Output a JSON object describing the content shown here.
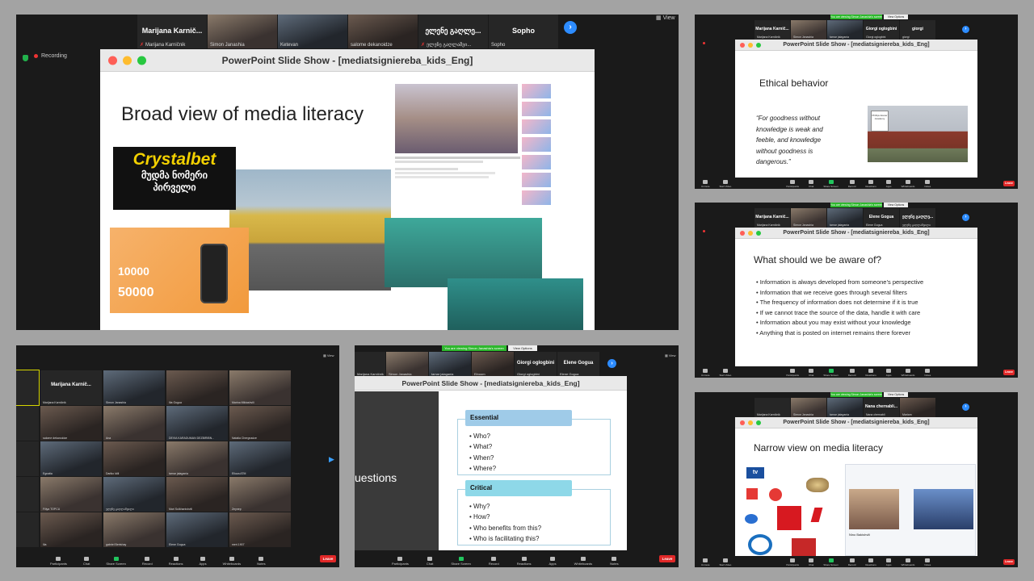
{
  "panel1": {
    "participants": [
      {
        "big": "Marijana  Karnič...",
        "name": "Marijana Karničnik"
      },
      {
        "big": "",
        "name": "Simon Janashia"
      },
      {
        "big": "",
        "name": "Ketevan"
      },
      {
        "big": "",
        "name": "salome dekanoidze"
      },
      {
        "big": "ელენე გაღლე...",
        "name": "ელენე გაღლაშვი..."
      },
      {
        "big": "Sopho",
        "name": "Sopho"
      }
    ],
    "view": "View",
    "recording": "Recording",
    "window_title": "PowerPoint Slide Show - [mediatsignierebа_kids_Eng]",
    "slide_title": "Broad view of media literacy",
    "crystalbet": "Crystalbet",
    "crystal_sub1": "მუდმა ნომერი",
    "crystal_sub2": "პირველი",
    "promo_num1": "10000",
    "promo_num2": "50000"
  },
  "panel2": {
    "banner": "You are viewing Simon Janashia's screen",
    "view_options": "View Options",
    "participants": [
      {
        "big": "Marijana  Karnič...",
        "name": "Marijana Karničnik"
      },
      {
        "big": "",
        "name": "Simon Janashia"
      },
      {
        "big": "",
        "name": "tamar jalagania"
      },
      {
        "big": "Giorgi oglogbini",
        "name": "Giorgi oglogbini"
      },
      {
        "big": "giorgi",
        "name": "giorgi"
      }
    ],
    "window_title": "PowerPoint Slide Show - [mediatsignierebа_kids_Eng]",
    "slide_title": "Ethical behavior",
    "quote": "“For goodness without knowledge is weak and feeble, and knowledge without goodness is dangerous.”",
    "sign_text": "Phillips Exeter Academy",
    "toolbar": [
      "Unmute",
      "Start Video",
      "Participants",
      "Chat",
      "Share Screen",
      "Record",
      "Reactions",
      "Apps",
      "Whiteboards",
      "Notes"
    ],
    "leave": "Leave"
  },
  "panel3": {
    "banner": "You are viewing Simon Janashia's screen",
    "view_options": "View Options",
    "participants": [
      {
        "big": "Marijana  Karnič...",
        "name": "Marijana Karničnik"
      },
      {
        "big": "",
        "name": "Simon Janashia"
      },
      {
        "big": "",
        "name": "tamar jalagania"
      },
      {
        "big": "Elene Gogua",
        "name": "Elene Gogua"
      },
      {
        "big": "ელენე გაღლე...",
        "name": "ელენე გაღლაშვილი"
      }
    ],
    "window_title": "PowerPoint Slide Show - [mediatsignierebа_kids_Eng]",
    "slide_title": "What should we be aware of?",
    "bullets": [
      "Information is always developed from someone’s perspective",
      "Information that we receive goes through several filters",
      "The frequency of information does not determine if it is true",
      "If we cannot trace the source of the data, handle it with care",
      "Information about you may exist without your knowledge",
      "Anything that is posted on internet remains there forever"
    ],
    "toolbar": [
      "Unmute",
      "Start Video",
      "Participants",
      "Chat",
      "Share Screen",
      "Record",
      "Reactions",
      "Apps",
      "Whiteboards",
      "Notes"
    ],
    "leave": "Leave"
  },
  "panel4": {
    "banner": "You are viewing Simon Janashia's screen",
    "view_options": "View Options",
    "participants": [
      {
        "big": "",
        "name": "Marijana Karničnik"
      },
      {
        "big": "",
        "name": "Simon Janashia"
      },
      {
        "big": "",
        "name": "tamar jalagania"
      },
      {
        "big": "Nana  chernabli...",
        "name": "Nana chernabli"
      },
      {
        "big": "",
        "name": "Mariam"
      }
    ],
    "window_title": "PowerPoint Slide Show - [mediatsignierebа_kids_Eng]",
    "slide_title": "Narrow view on media literacy",
    "person_name": "Nino Bakishvili",
    "toolbar": [
      "Unmute",
      "Start Video",
      "Participants",
      "Chat",
      "Share Screen",
      "Record",
      "Reactions",
      "Apps",
      "Whiteboards",
      "Notes"
    ],
    "leave": "Leave"
  },
  "panel5": {
    "view": "View",
    "grid": [
      {
        "big": "",
        "name": ""
      },
      {
        "big": "Marijana  Karnič...",
        "name": "Marijana Karničnik"
      },
      {
        "big": "",
        "name": "Simon Janashia"
      },
      {
        "big": "",
        "name": "Ilia Gogua"
      },
      {
        "big": "",
        "name": "Marina Mikiashvili"
      },
      {
        "big": "",
        "name": ""
      },
      {
        "big": "",
        "name": "salome dekanoidze"
      },
      {
        "big": "",
        "name": "Ana"
      },
      {
        "big": "",
        "name": "DEVIA KARADUMAN DEZBIRIBN..."
      },
      {
        "big": "",
        "name": "Natalia Chergnadze"
      },
      {
        "big": "",
        "name": ""
      },
      {
        "big": "",
        "name": "Egnatia"
      },
      {
        "big": "",
        "name": "Dariko Idili"
      },
      {
        "big": "",
        "name": "tamar jalagania"
      },
      {
        "big": "",
        "name": "Eliuza ATM"
      },
      {
        "big": "",
        "name": ""
      },
      {
        "big": "",
        "name": "Filiya TOPCU"
      },
      {
        "big": "",
        "name": "ელენე გაღლაშვილი"
      },
      {
        "big": "",
        "name": "Mari Sulkhanishvili"
      },
      {
        "big": "",
        "name": "Zeynep"
      },
      {
        "big": "",
        "name": ""
      },
      {
        "big": "",
        "name": "Ilia"
      },
      {
        "big": "",
        "name": "gabriel Bertshay"
      },
      {
        "big": "",
        "name": "Elene Gogua"
      },
      {
        "big": "",
        "name": "meri.1907"
      }
    ],
    "toolbar": [
      "Participants",
      "Chat",
      "Share Screen",
      "Record",
      "Reactions",
      "Apps",
      "Whiteboards",
      "Notes"
    ],
    "leave": "Leave"
  },
  "panel6": {
    "banner": "You are viewing Simon Janashia's screen",
    "view_options": "View Options",
    "view": "View",
    "participants": [
      {
        "big": "",
        "name": "Marijana Karničnik"
      },
      {
        "big": "",
        "name": "Simon Janashia"
      },
      {
        "big": "",
        "name": "tamar jalagania"
      },
      {
        "big": "",
        "name": "Elnoom"
      },
      {
        "big": "Giorgi oglogbini",
        "name": "Giorgi oglogbini"
      },
      {
        "big": "Elene Gogua",
        "name": "Elene Gogua"
      }
    ],
    "window_title": "PowerPoint Slide Show - [mediatsignierebа_kids_Eng]",
    "side_text": "uestions",
    "essential": "Essential",
    "essential_items": [
      "Who?",
      "What?",
      "When?",
      "Where?"
    ],
    "critical": "Critical",
    "critical_items": [
      "Why?",
      "How?",
      "Who benefits from this?",
      "Who is facilitating this?"
    ],
    "toolbar": [
      "Participants",
      "Chat",
      "Share Screen",
      "Record",
      "Reactions",
      "Apps",
      "Whiteboards",
      "Notes"
    ],
    "leave": "Leave"
  },
  "colors": {
    "zoom_blue": "#2d8cff",
    "leave_red": "#e02828",
    "share_green": "#2eb82e"
  }
}
